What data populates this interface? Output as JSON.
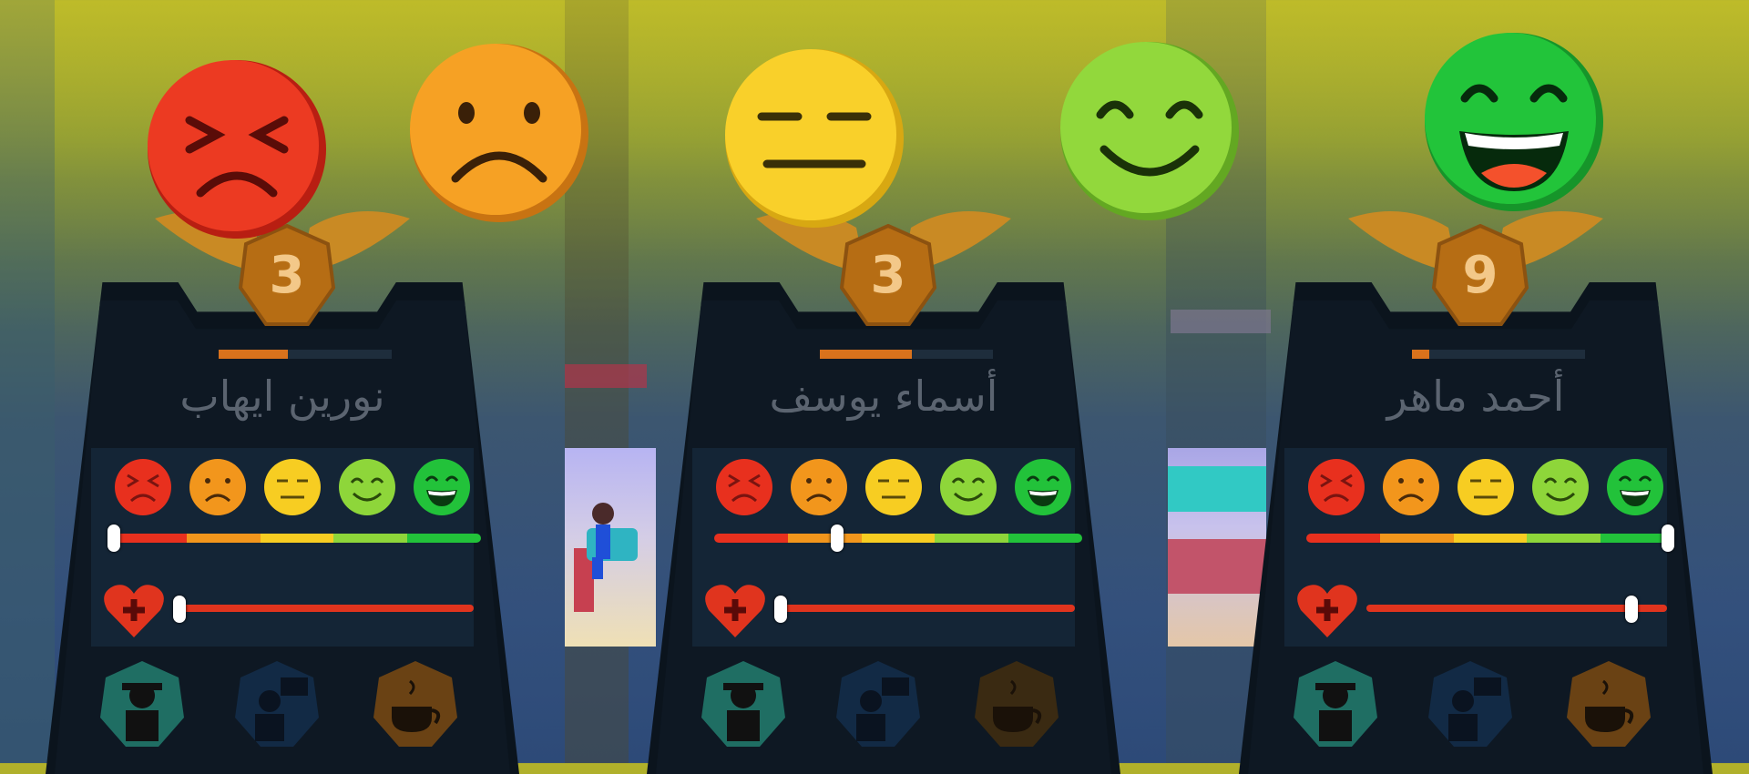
{
  "players": [
    {
      "name": "نورين ايهاب",
      "level": "3",
      "xp_fraction": 0.4,
      "mood_value": 0.0,
      "health_value": 0.0
    },
    {
      "name": "أسماء يوسف",
      "level": "3",
      "xp_fraction": 0.53,
      "mood_value": 0.33,
      "health_value": 0.0
    },
    {
      "name": "أحمد ماهر",
      "level": "9",
      "xp_fraction": 0.1,
      "mood_value": 1.0,
      "health_value": 0.86
    }
  ],
  "mood_scale": [
    "angry",
    "sad",
    "neutral",
    "happy",
    "very-happy"
  ],
  "colors": {
    "angry": "#e8301e",
    "sad": "#f2961c",
    "neutral": "#f7cd22",
    "happy": "#8ed63a",
    "very_happy": "#22c23a",
    "health": "#e0341e",
    "xp": "#d9721c"
  },
  "icons": [
    "angry-face-icon",
    "sad-face-icon",
    "neutral-face-icon",
    "smile-face-icon",
    "laughing-face-icon",
    "heart-plus-icon",
    "spy-agent-icon",
    "chat-person-icon",
    "coffee-cup-icon"
  ]
}
